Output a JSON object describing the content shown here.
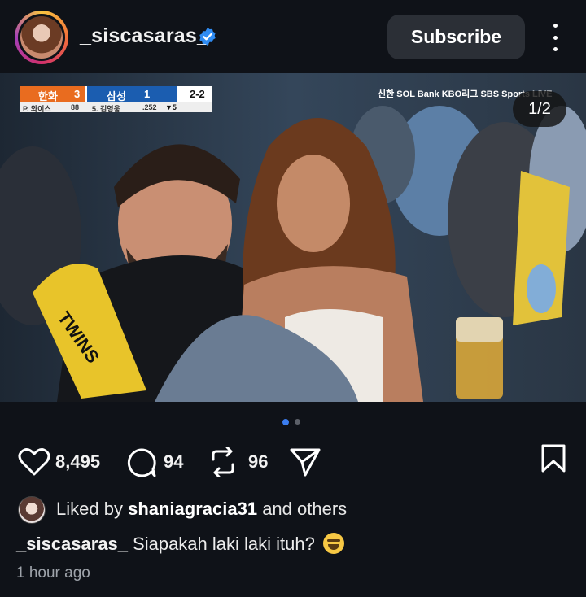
{
  "post": {
    "username": "_siscasaras_",
    "verified": true,
    "subscribe_label": "Subscribe",
    "more_icon": "more-vertical-icon",
    "media_counter": "1/2",
    "carousel_dots": 2,
    "carousel_active": 1
  },
  "scoreboard": {
    "team1": "한화",
    "team1_score": "3",
    "team2": "삼성",
    "team2_score": "1",
    "count": "2-2",
    "inning": "▼5",
    "pitcher": "P. 와이스",
    "pitches": "88",
    "batter": "5. 김영웅",
    "avg": ".252",
    "broadcaster": "신한 SOL Bank KBO리그  SBS Sports LIVE"
  },
  "actions": {
    "likes": "8,495",
    "comments": "94",
    "reposts": "96",
    "icons": [
      "heart-icon",
      "comment-icon",
      "repost-icon",
      "share-icon",
      "bookmark-icon"
    ]
  },
  "liked_by": {
    "prefix": "Liked by",
    "name": "shaniagracia31",
    "suffix": "and others"
  },
  "caption": {
    "username": "_siscasaras_",
    "text": "Siapakah laki laki ituh?"
  },
  "timestamp": "1 hour ago",
  "colors": {
    "background": "#0f1218",
    "verified_blue": "#2f8cf3",
    "active_dot": "#3b7df0",
    "inactive_dot": "#5c6068"
  }
}
